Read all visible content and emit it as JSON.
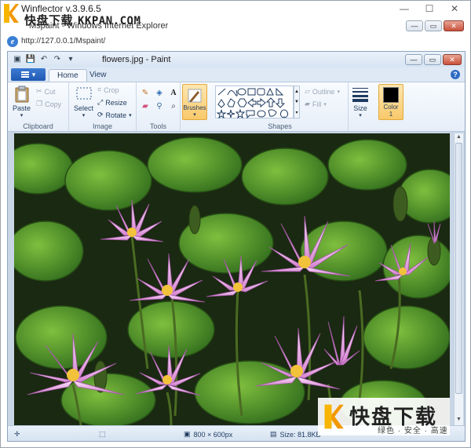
{
  "outer": {
    "title": "Winflector v.3.9.6.5",
    "controls": {
      "minimize": "—",
      "maximize": "☐",
      "close": "✕"
    }
  },
  "watermark": {
    "brand": "快盘下载",
    "site": "KKPAN.COM",
    "bottom_brand": "快盘下载",
    "bottom_slogan": "绿色 · 安全 · 高速"
  },
  "ie": {
    "title": "Mspaint - Windows Internet Explorer",
    "address": "http://127.0.0.1/Mspaint/",
    "controls": {
      "minimize": "—",
      "maximize": "▭",
      "close": "✕"
    }
  },
  "paint": {
    "title": "flowers.jpg - Paint",
    "qat_icons": [
      "paint-app-icon",
      "save-icon",
      "undo-icon",
      "redo-icon",
      "customize-icon"
    ],
    "controls": {
      "minimize": "—",
      "maximize": "▭",
      "close": "✕"
    },
    "tabs": {
      "home": "Home",
      "view": "View"
    },
    "clipboard": {
      "paste": "Paste",
      "cut": "Cut",
      "copy": "Copy",
      "label": "Clipboard"
    },
    "image": {
      "select": "Select",
      "crop": "Crop",
      "resize": "Resize",
      "rotate": "Rotate",
      "label": "Image"
    },
    "tools": {
      "label": "Tools"
    },
    "brushes": {
      "label": "Brushes"
    },
    "shapes": {
      "outline": "Outline",
      "fill": "Fill",
      "label": "Shapes"
    },
    "size": {
      "label": "Size"
    },
    "color1": {
      "label_line1": "Color",
      "label_line2": "1",
      "value": "#000000"
    },
    "status": {
      "dimensions": "800 × 600px",
      "size": "Size: 81.8KB"
    }
  }
}
